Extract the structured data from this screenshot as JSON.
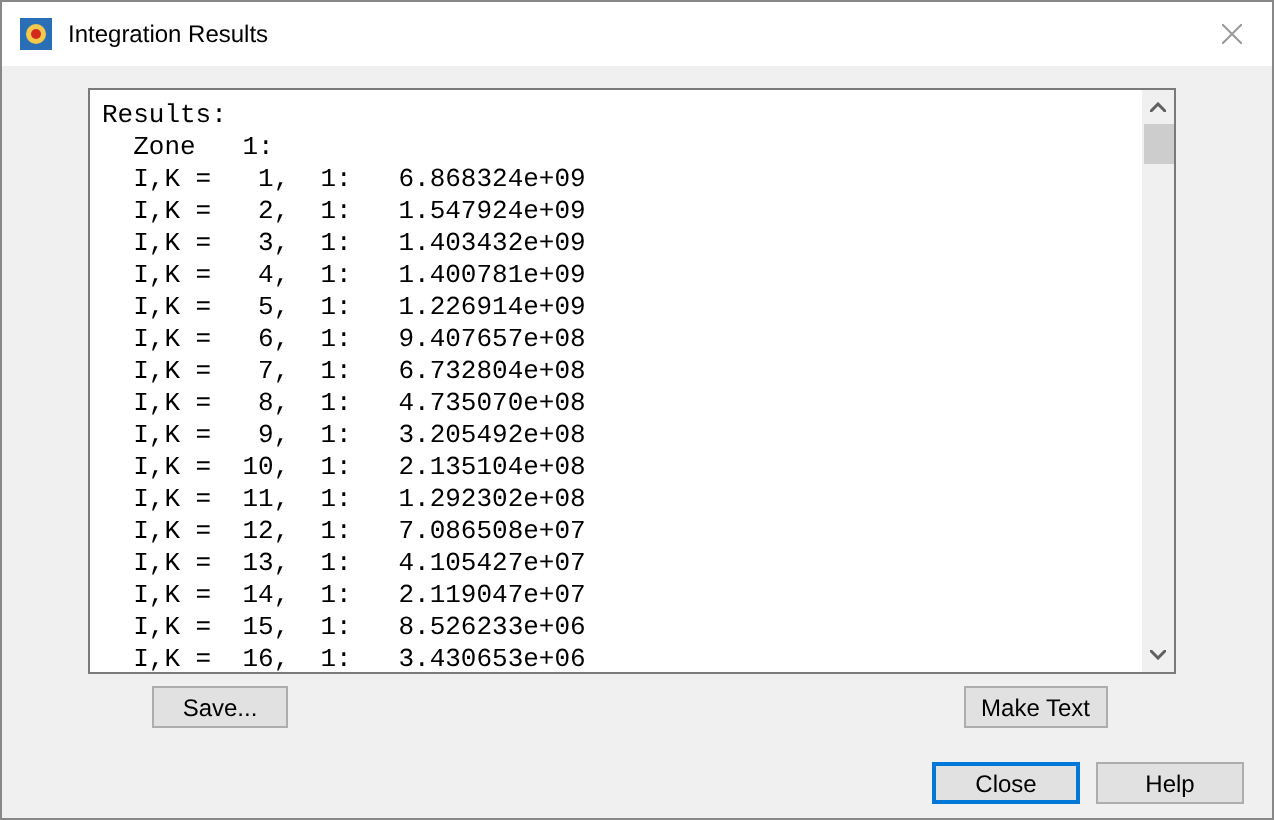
{
  "window": {
    "title": "Integration Results"
  },
  "results": {
    "lines": [
      "Results:",
      "  Zone   1:",
      "  I,K =   1,  1:   6.868324e+09",
      "  I,K =   2,  1:   1.547924e+09",
      "  I,K =   3,  1:   1.403432e+09",
      "  I,K =   4,  1:   1.400781e+09",
      "  I,K =   5,  1:   1.226914e+09",
      "  I,K =   6,  1:   9.407657e+08",
      "  I,K =   7,  1:   6.732804e+08",
      "  I,K =   8,  1:   4.735070e+08",
      "  I,K =   9,  1:   3.205492e+08",
      "  I,K =  10,  1:   2.135104e+08",
      "  I,K =  11,  1:   1.292302e+08",
      "  I,K =  12,  1:   7.086508e+07",
      "  I,K =  13,  1:   4.105427e+07",
      "  I,K =  14,  1:   2.119047e+07",
      "  I,K =  15,  1:   8.526233e+06",
      "  I,K =  16,  1:   3.430653e+06"
    ]
  },
  "actions": [
    {
      "label": "Save..."
    },
    {
      "label": "Make Text"
    }
  ],
  "buttons": [
    {
      "label": "Close",
      "focused": true
    },
    {
      "label": "Help",
      "focused": false
    }
  ]
}
